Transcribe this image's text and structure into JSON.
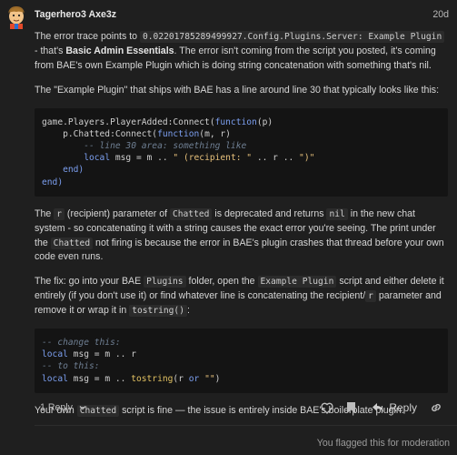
{
  "post": {
    "username": "Tagerhero3 Axe3z",
    "date": "20d",
    "p1_a": "The error trace points to ",
    "p1_code": "0.02201785289499927.Config.Plugins.Server: Example Plugin",
    "p1_b": " - that's ",
    "p1_bold": "Basic Admin Essentials",
    "p1_c": ". The error isn't coming from the script you posted, it's coming from BAE's own Example Plugin which is doing string concatenation with something that's nil.",
    "p2": "The \"Example Plugin\" that ships with BAE has a line around line 30 that typically looks like this:",
    "code1": {
      "l1a": "game.Players.PlayerAdded:Connect(",
      "l1kw": "function",
      "l1b": "(p)",
      "l2a": "    p.Chatted:Connect(",
      "l2kw": "function",
      "l2b": "(m, r)",
      "l3": "        -- line 30 area: something like",
      "l4kw": "local",
      "l4a": " msg = m .. ",
      "l4s": "\" (recipient: \"",
      "l4b": " .. r .. ",
      "l4s2": "\")\"",
      "l5": "    end)",
      "l6": "end)"
    },
    "p3_a": "The ",
    "p3_r": "r",
    "p3_b": " (recipient) parameter of ",
    "p3_chatted": "Chatted",
    "p3_c": " is deprecated and returns ",
    "p3_nil": "nil",
    "p3_d": " in the new chat system - so concatenating it with a string causes the exact error you're seeing. The print under the ",
    "p3_chatted2": "Chatted",
    "p3_e": " not firing is because the error in BAE's plugin crashes that thread before your own code even runs.",
    "p4_a": "The fix: go into your BAE ",
    "p4_plugins": "Plugins",
    "p4_b": " folder, open the ",
    "p4_example": "Example Plugin",
    "p4_c": " script and either delete it entirely (if you don't use it) or find whatever line is concatenating the recipient/",
    "p4_r": "r",
    "p4_d": " parameter and remove it or wrap it in ",
    "p4_tostring": "tostring()",
    "p4_e": ":",
    "code2": {
      "l1": "-- change this:",
      "l2kw": "local",
      "l2a": " msg = m .. r",
      "l3": "-- to this:",
      "l4kw": "local",
      "l4a": " msg = m .. ",
      "l4fn": "tostring",
      "l4b": "(r ",
      "l4or": "or",
      "l4c": " ",
      "l4s": "\"\"",
      "l4d": ")"
    },
    "p5_a": "Your own ",
    "p5_code": "Chatted",
    "p5_b": " script is fine — the issue is entirely inside BAE's boilerplate plugin."
  },
  "footer": {
    "replies": "1 Reply",
    "reply_label": "Reply",
    "flag_note": "You flagged this for moderation"
  },
  "icons": [
    "chevron-down-icon",
    "heart-icon",
    "bookmark-icon",
    "reply-arrow-icon",
    "link-icon"
  ],
  "colors": {
    "background": "#1f1f1f",
    "code_bg": "#141414",
    "text": "#d6d6d6",
    "keyword": "#7c9ff0",
    "string": "#e6c07b"
  }
}
